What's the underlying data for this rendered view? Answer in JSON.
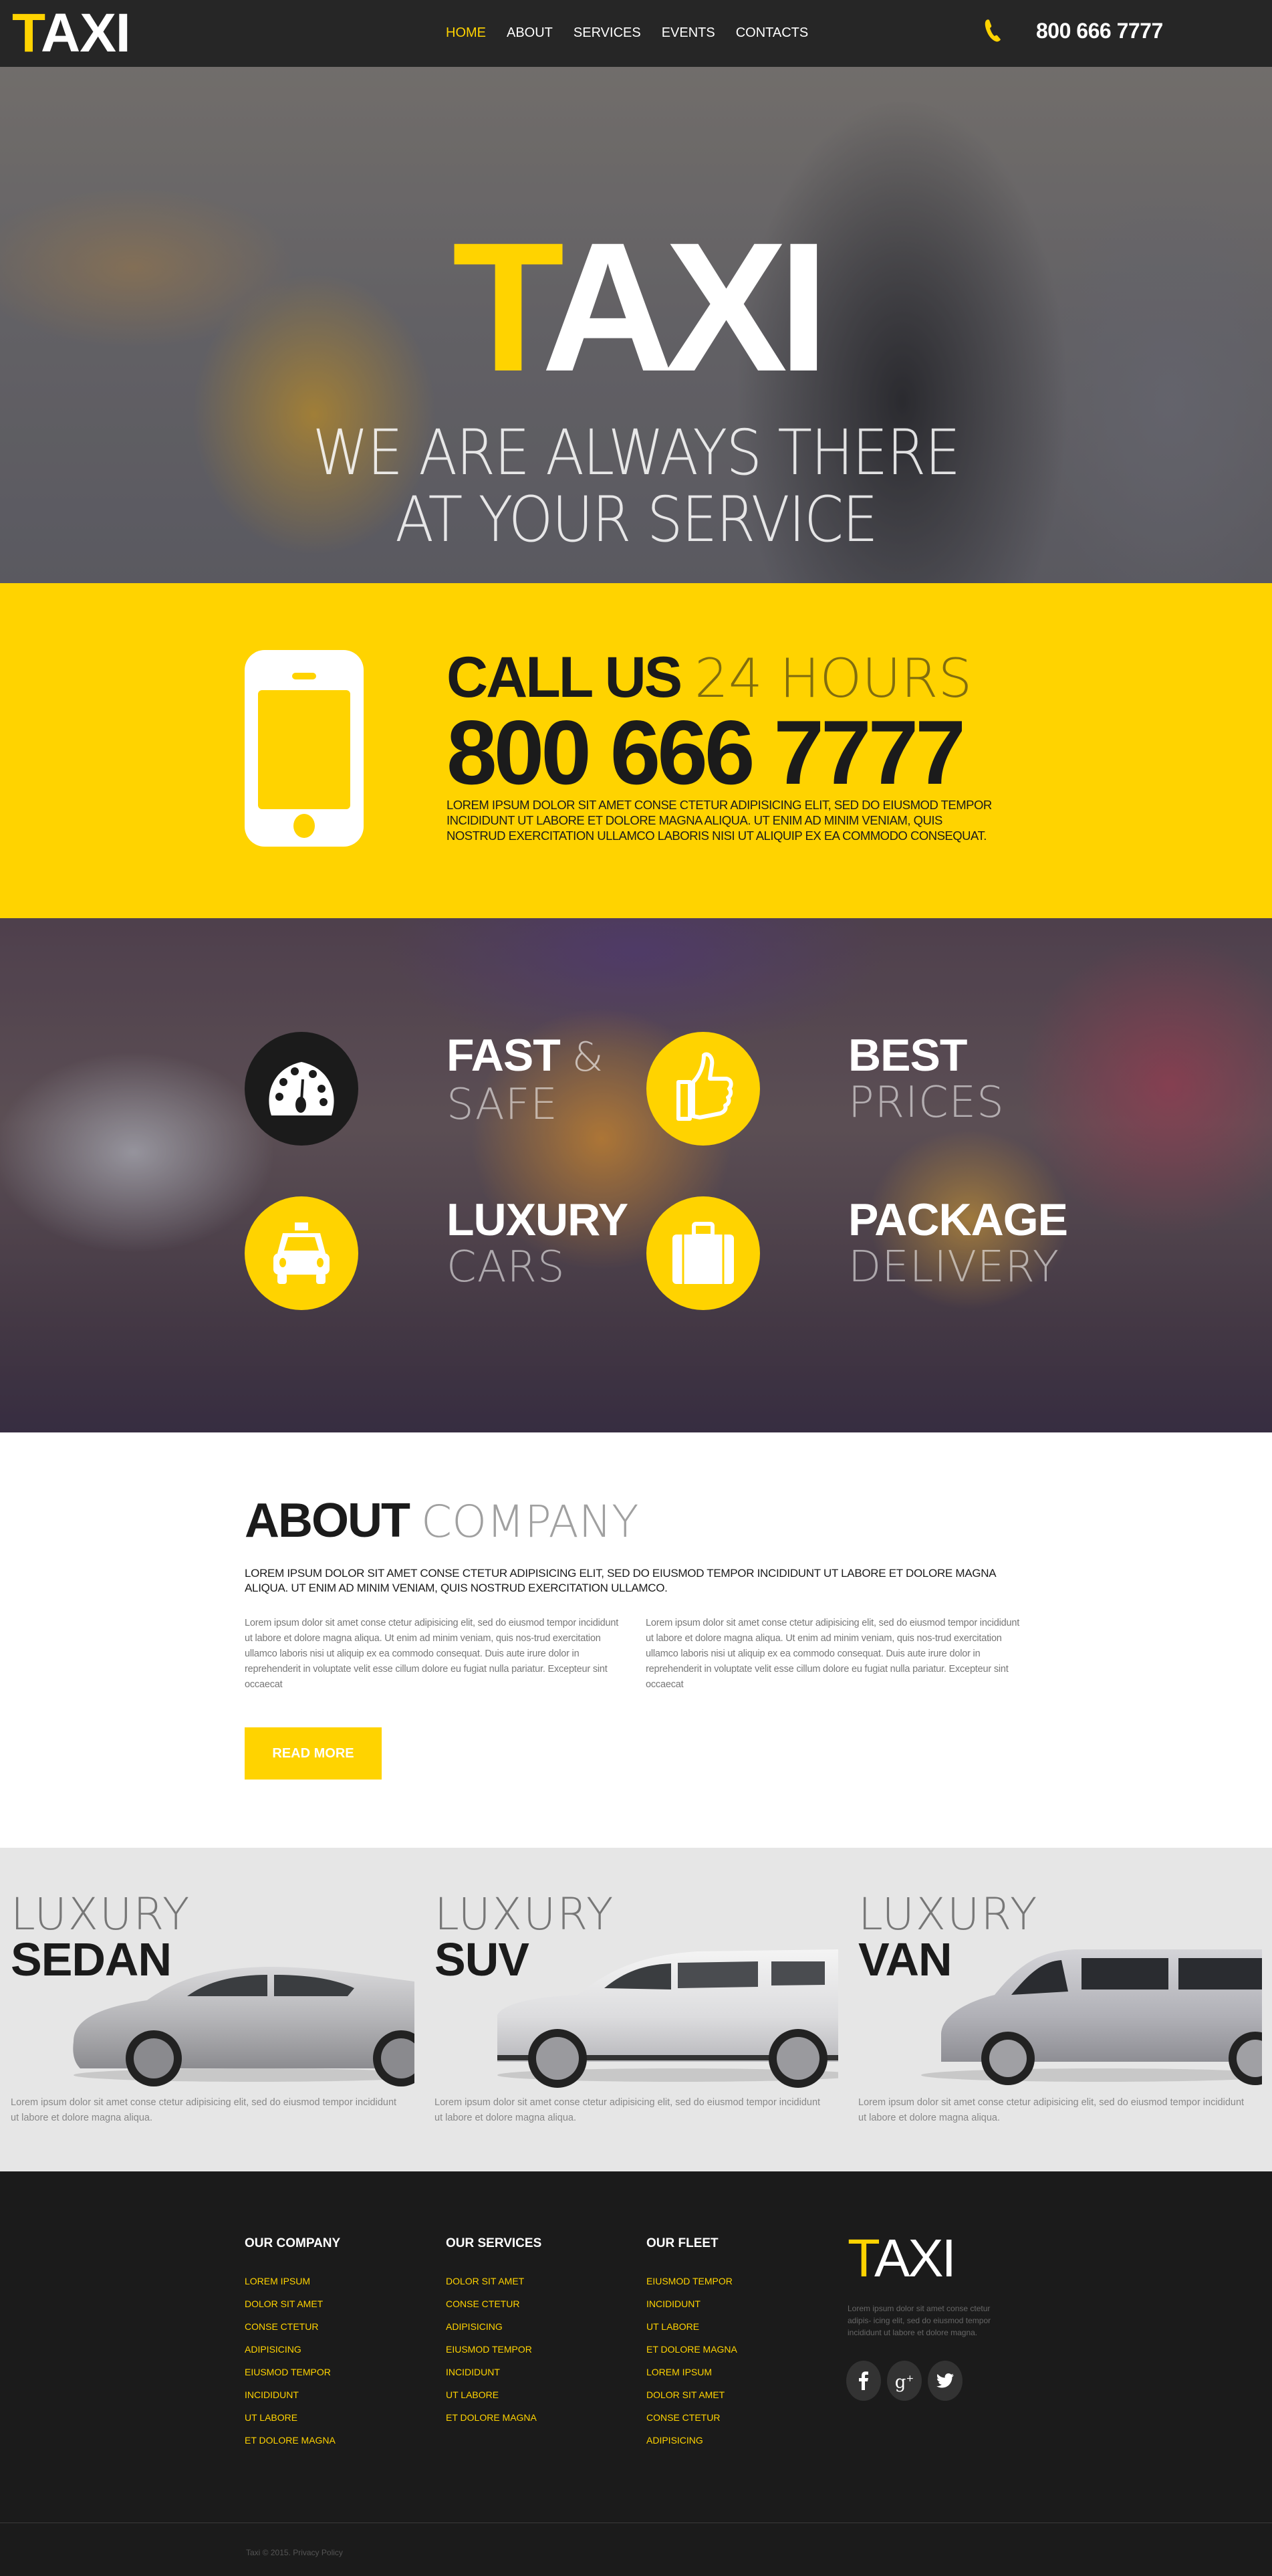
{
  "header": {
    "logo_first": "T",
    "logo_rest": "AXI",
    "nav": [
      {
        "label": "HOME",
        "active": true
      },
      {
        "label": "ABOUT",
        "active": false
      },
      {
        "label": "SERVICES",
        "active": false
      },
      {
        "label": "EVENTS",
        "active": false
      },
      {
        "label": "CONTACTS",
        "active": false
      }
    ],
    "phone_icon": "phone-icon",
    "phone": "800 666 7777"
  },
  "hero": {
    "title_first": "T",
    "title_rest": "AXI",
    "subtitle_line1": "WE ARE ALWAYS THERE",
    "subtitle_line2": "AT YOUR SERVICE"
  },
  "call": {
    "icon": "smartphone-icon",
    "heading_bold": "CALL US",
    "heading_light": "24 HOURS",
    "number": "800 666 7777",
    "description": "Lorem ipsum dolor sit amet conse ctetur adipisicing elit, sed do eiusmod tempor incididunt ut labore et dolore magna aliqua. Ut enim ad minim veniam, quis nostrud exercitation ullamco laboris nisi ut aliquip ex ea commodo consequat."
  },
  "features": [
    {
      "icon": "speedometer-icon",
      "bold": "FAST",
      "amp": "&",
      "thin": "SAFE",
      "style": "dark"
    },
    {
      "icon": "thumbs-up-icon",
      "bold": "BEST",
      "amp": "",
      "thin": "PRICES",
      "style": "yellow"
    },
    {
      "icon": "taxi-car-icon",
      "bold": "LUXURY",
      "amp": "",
      "thin": "CARS",
      "style": "yellow"
    },
    {
      "icon": "suitcase-icon",
      "bold": "PACKAGE",
      "amp": "",
      "thin": "DELIVERY",
      "style": "yellow"
    }
  ],
  "about": {
    "heading_bold": "ABOUT",
    "heading_light": "COMPANY",
    "lead": "Lorem ipsum dolor sit amet conse ctetur adipisicing elit, sed do eiusmod tempor incididunt ut labore et dolore magna aliqua. Ut enim ad minim veniam, quis nostrud exercitation ullamco.",
    "col1": "Lorem ipsum dolor sit amet conse ctetur adipisicing elit, sed do eiusmod tempor incididunt ut labore et dolore magna aliqua. Ut enim ad minim veniam, quis nos-trud exercitation ullamco laboris nisi ut aliquip ex ea commodo consequat. Duis aute irure dolor in reprehenderit in voluptate velit esse cillum dolore eu fugiat nulla pariatur. Excepteur sint occaecat",
    "col2": "Lorem ipsum dolor sit amet conse ctetur adipisicing elit, sed do eiusmod tempor incididunt ut labore et dolore magna aliqua. Ut enim ad minim veniam, quis nos-trud exercitation ullamco laboris nisi ut aliquip ex ea commodo consequat. Duis aute irure dolor in reprehenderit in voluptate velit esse cillum dolore eu fugiat nulla pariatur. Excepteur sint occaecat",
    "button": "READ MORE"
  },
  "fleet": [
    {
      "light": "LUXURY",
      "type": "SEDAN",
      "image": "sedan-image",
      "desc": "Lorem ipsum dolor sit amet conse ctetur adipisicing elit, sed do eiusmod tempor incididunt ut labore et dolore magna aliqua."
    },
    {
      "light": "LUXURY",
      "type": "SUV",
      "image": "suv-image",
      "desc": "Lorem ipsum dolor sit amet conse ctetur adipisicing elit, sed do eiusmod tempor incididunt ut labore et dolore magna aliqua."
    },
    {
      "light": "LUXURY",
      "type": "VAN",
      "image": "van-image",
      "desc": "Lorem ipsum dolor sit amet conse ctetur adipisicing elit, sed do eiusmod tempor incididunt ut labore et dolore magna aliqua."
    }
  ],
  "footer": {
    "columns": [
      {
        "title": "OUR COMPANY",
        "links": [
          "LOREM IPSUM",
          "DOLOR SIT AMET",
          "CONSE CTETUR",
          "ADIPISICING",
          "EIUSMOD TEMPOR",
          "INCIDIDUNT",
          "UT LABORE",
          "ET DOLORE MAGNA"
        ]
      },
      {
        "title": "OUR SERVICES",
        "links": [
          "DOLOR SIT AMET",
          "CONSE CTETUR",
          "ADIPISICING",
          "EIUSMOD TEMPOR",
          "INCIDIDUNT",
          "UT LABORE",
          "ET DOLORE MAGNA"
        ]
      },
      {
        "title": "OUR FLEET",
        "links": [
          "EIUSMOD TEMPOR",
          "INCIDIDUNT",
          "UT LABORE",
          "ET DOLORE MAGNA",
          "LOREM IPSUM",
          "DOLOR SIT AMET",
          "CONSE CTETUR",
          "ADIPISICING"
        ]
      }
    ],
    "logo_first": "T",
    "logo_rest": "AXI",
    "description": "Lorem ipsum dolor sit amet conse ctetur adipis- icing elit, sed do eiusmod tempor incididunt ut labore et dolore magna.",
    "social": [
      {
        "icon": "facebook-icon",
        "glyph": "f"
      },
      {
        "icon": "google-plus-icon",
        "glyph": "g+"
      },
      {
        "icon": "twitter-icon",
        "glyph": "t"
      }
    ],
    "copyright": "Taxi © 2015. Privacy Policy"
  },
  "colors": {
    "accent": "#ffd300",
    "dark": "#1b1b1b",
    "header_bg": "#262626",
    "fleet_bg": "#e6e6e6"
  }
}
